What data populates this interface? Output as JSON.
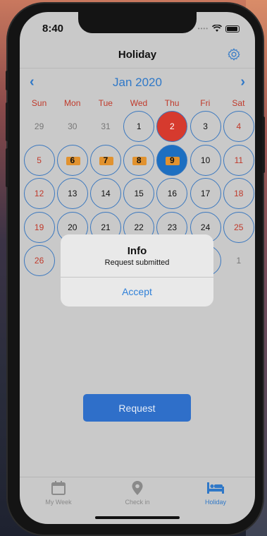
{
  "status": {
    "time": "8:40"
  },
  "navbar": {
    "title": "Holiday",
    "settings_icon": "gear-icon"
  },
  "calendar": {
    "month": "Jan 2020",
    "prev_icon": "chevron-left-icon",
    "next_icon": "chevron-right-icon",
    "weekdays": [
      "Sun",
      "Mon",
      "Tue",
      "Wed",
      "Thu",
      "Fri",
      "Sat"
    ],
    "weekday_color": "#c03a2b",
    "rows": [
      [
        {
          "d": "29",
          "style": "muted"
        },
        {
          "d": "30",
          "style": "muted"
        },
        {
          "d": "31",
          "style": "muted"
        },
        {
          "d": "1",
          "style": "black-ring"
        },
        {
          "d": "2",
          "style": "today"
        },
        {
          "d": "3",
          "style": "black-ring"
        },
        {
          "d": "4",
          "style": "red-ring"
        }
      ],
      [
        {
          "d": "5",
          "style": "red-ring"
        },
        {
          "d": "6",
          "style": "holiday"
        },
        {
          "d": "7",
          "style": "holiday"
        },
        {
          "d": "8",
          "style": "holiday"
        },
        {
          "d": "9",
          "style": "selected-holiday"
        },
        {
          "d": "10",
          "style": "black-ring"
        },
        {
          "d": "11",
          "style": "red-ring"
        }
      ],
      [
        {
          "d": "12",
          "style": "red-ring"
        },
        {
          "d": "13",
          "style": "black-ring"
        },
        {
          "d": "14",
          "style": "black-ring"
        },
        {
          "d": "15",
          "style": "black-ring"
        },
        {
          "d": "16",
          "style": "black-ring"
        },
        {
          "d": "17",
          "style": "black-ring"
        },
        {
          "d": "18",
          "style": "red-ring"
        }
      ],
      [
        {
          "d": "19",
          "style": "red-ring"
        },
        {
          "d": "20",
          "style": "black-ring"
        },
        {
          "d": "21",
          "style": "black-ring"
        },
        {
          "d": "22",
          "style": "black-ring"
        },
        {
          "d": "23",
          "style": "black-ring"
        },
        {
          "d": "24",
          "style": "black-ring"
        },
        {
          "d": "25",
          "style": "red-ring"
        }
      ],
      [
        {
          "d": "26",
          "style": "red-ring"
        },
        {
          "d": "",
          "style": "hidden"
        },
        {
          "d": "",
          "style": "hidden"
        },
        {
          "d": "",
          "style": "hidden"
        },
        {
          "d": "",
          "style": "hidden"
        },
        {
          "d": "",
          "style": "ring-only"
        },
        {
          "d": "1",
          "style": "muted"
        }
      ]
    ]
  },
  "alert": {
    "title": "Info",
    "message": "Request submitted",
    "button": "Accept"
  },
  "request_button": {
    "label": "Request"
  },
  "tabbar": {
    "tabs": [
      {
        "label": "My Week",
        "icon": "calendar-icon",
        "active": false
      },
      {
        "label": "Check in",
        "icon": "location-pin-icon",
        "active": false
      },
      {
        "label": "Holiday",
        "icon": "bed-icon",
        "active": true
      }
    ]
  },
  "colors": {
    "accent": "#2f78c8",
    "today": "#d63a2e",
    "selected": "#1d6fc1",
    "holiday_marker": "#e1922f"
  }
}
